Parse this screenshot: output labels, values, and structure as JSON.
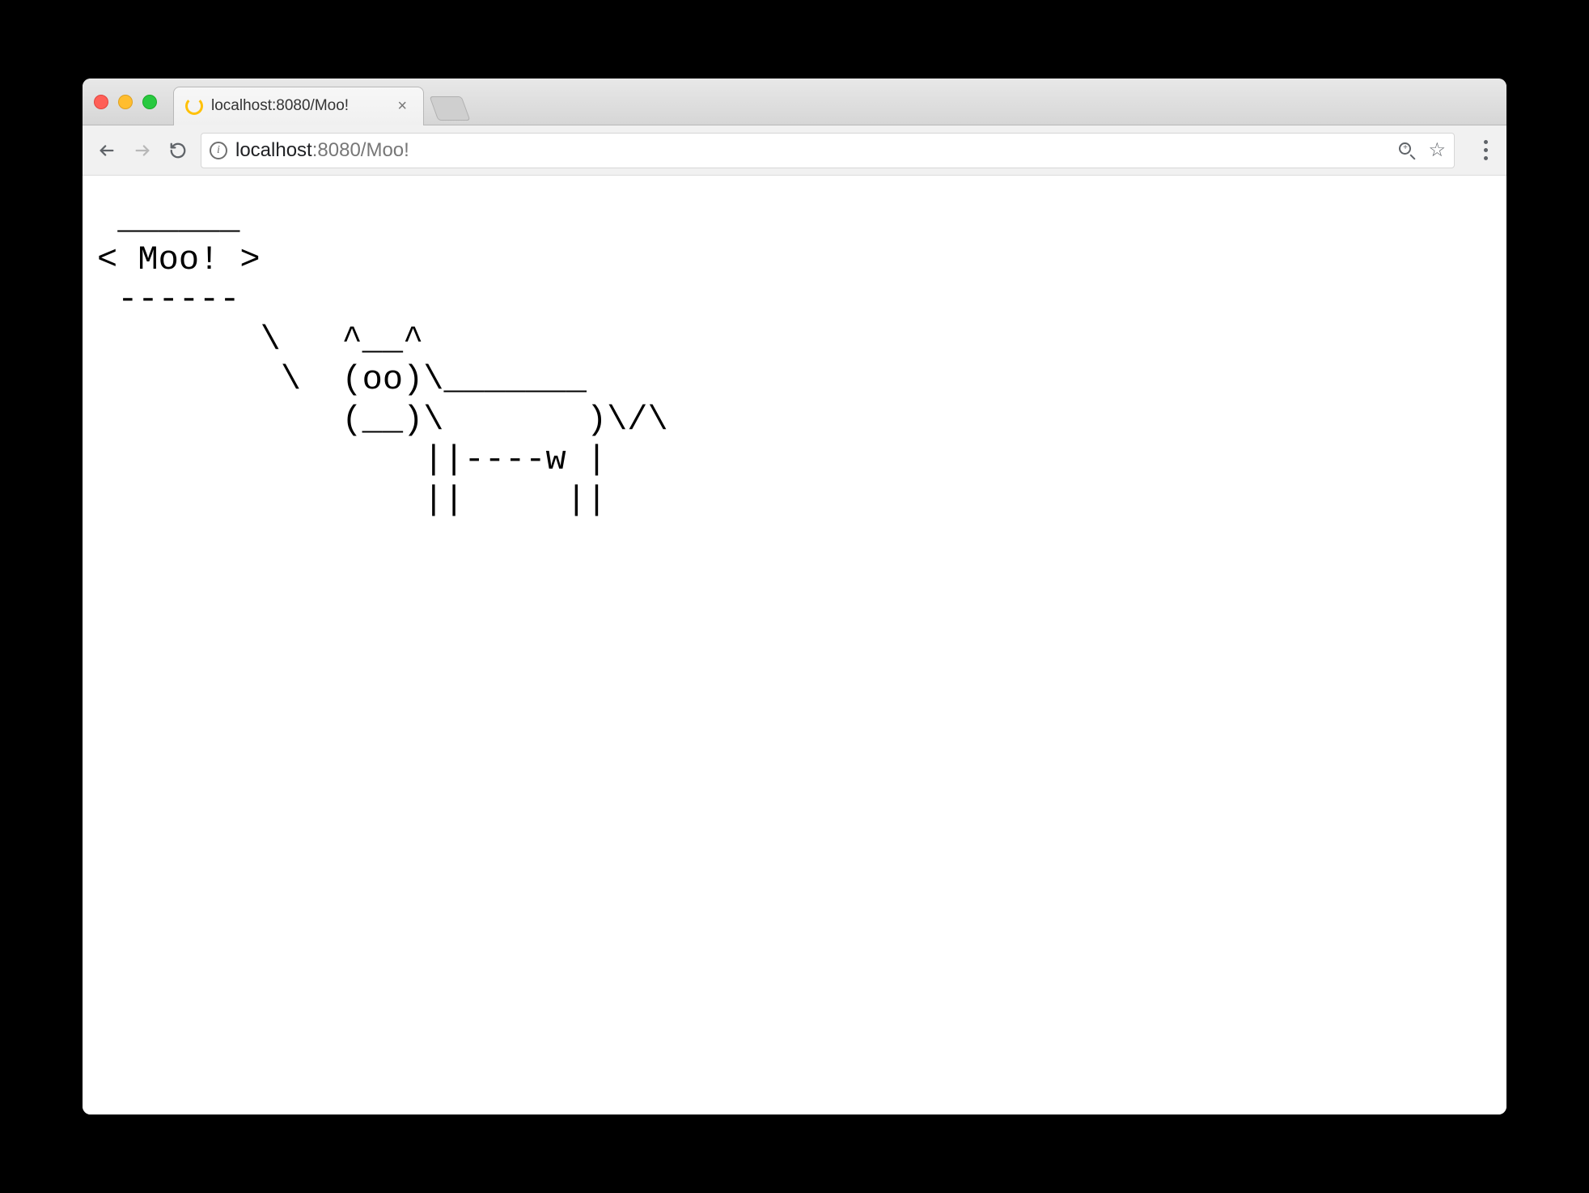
{
  "tab": {
    "title": "localhost:8080/Moo!",
    "close_glyph": "×"
  },
  "url": {
    "host": "localhost",
    "port_path": ":8080/Moo!"
  },
  "apple_glyph": "",
  "content": {
    "cowsay": " ______\n< Moo! >\n ------\n        \\   ^__^\n         \\  (oo)\\_______\n            (__)\\       )\\/\\\n                ||----w |\n                ||     ||"
  }
}
